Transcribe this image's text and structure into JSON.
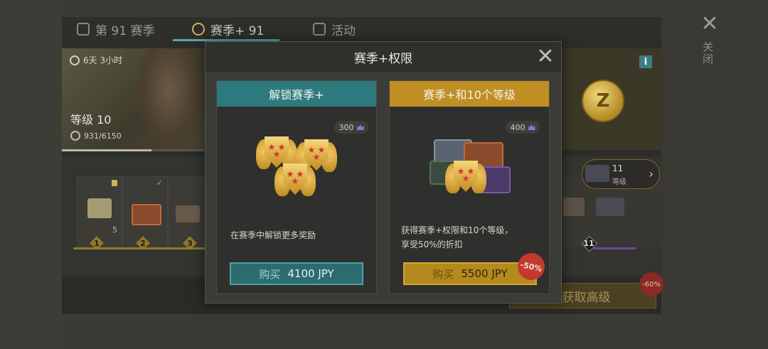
{
  "tabs": [
    {
      "label": "第 91 赛季",
      "icon": "season-badge-icon"
    },
    {
      "label": "赛季+ 91",
      "icon": "season-plus-badge-icon",
      "active": true
    },
    {
      "label": "活动",
      "icon": "calendar-icon"
    }
  ],
  "hero": {
    "time_left": "6天 3小时",
    "level_label": "等级 10",
    "xp": "931/6150",
    "xp_progress": 0.63
  },
  "track": {
    "first_item_count": "5",
    "levels": [
      "1",
      "2",
      "3"
    ],
    "right_level": "11"
  },
  "right_panel": {
    "coin_letter": "Z",
    "info_glyph": "i",
    "reward_level_num": "11",
    "reward_level_label": "等级"
  },
  "bottom": {
    "get_higher_label": "获取高级",
    "discount": "-60%"
  },
  "outer_close_label": "关闭",
  "modal": {
    "title": "赛季+权限",
    "offers": [
      {
        "header": "解锁赛季+",
        "price_points": "300",
        "description": "在赛季中解锁更多奖励",
        "buy_label": "购买",
        "price": "4100 JPY"
      },
      {
        "header": "赛季+和10个等级",
        "price_points": "400",
        "description_line1": "获得赛季+权限和10个等级，",
        "description_line2": "享受50%的折扣",
        "buy_label": "购买",
        "price": "5500 JPY",
        "discount": "-50%"
      }
    ]
  },
  "colors": {
    "teal_accent": "#2c7a7d",
    "gold_accent": "#c08e22",
    "sale_red": "#c23a2c"
  }
}
